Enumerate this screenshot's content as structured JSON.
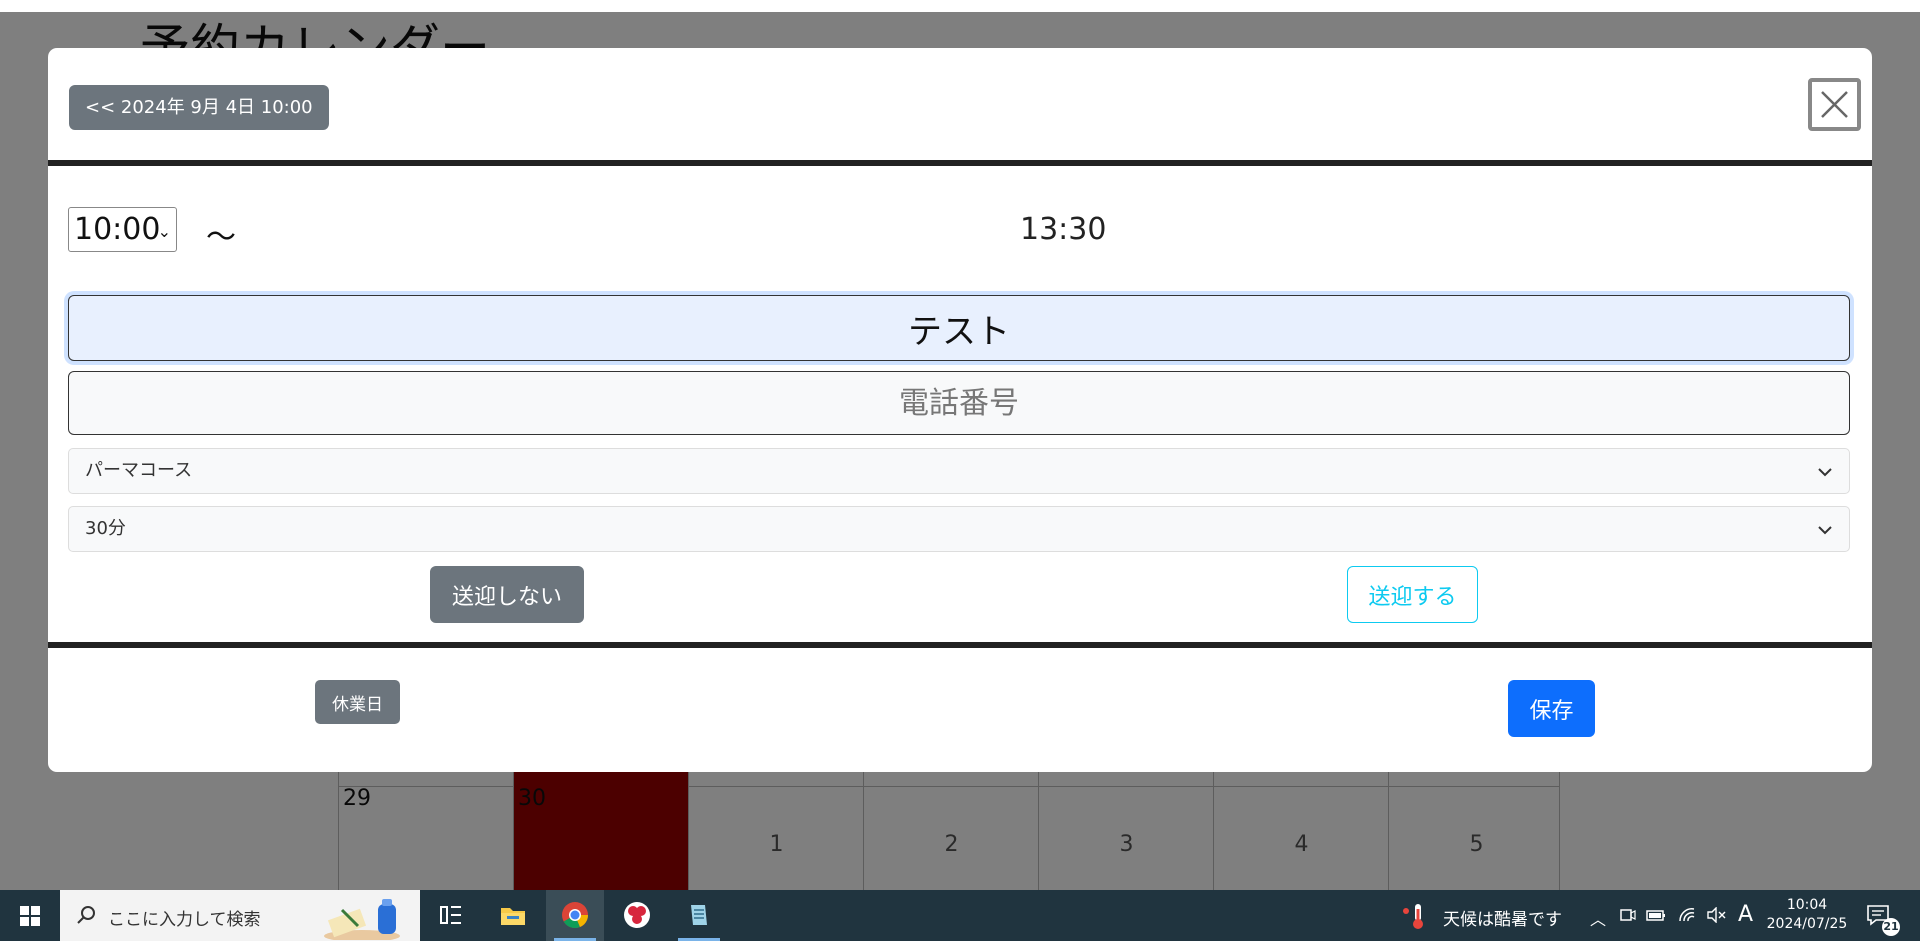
{
  "background": {
    "page_title": "予約カレンダー",
    "calendar_days": [
      {
        "num": "29",
        "today": false,
        "pos": "corner"
      },
      {
        "num": "30",
        "today": true,
        "pos": "corner"
      },
      {
        "num": "1",
        "today": false,
        "pos": "center"
      },
      {
        "num": "2",
        "today": false,
        "pos": "center"
      },
      {
        "num": "3",
        "today": false,
        "pos": "center"
      },
      {
        "num": "4",
        "today": false,
        "pos": "center"
      },
      {
        "num": "5",
        "today": false,
        "pos": "center"
      }
    ]
  },
  "modal": {
    "prev_label": "<< 2024年 9月 4日 10:00",
    "start_time": "10:00",
    "tilde": "〜",
    "end_time": "13:30",
    "name_value": "テスト",
    "phone_placeholder": "電話番号",
    "course_selected": "パーマコース",
    "duration_selected": "30分",
    "pickup_no_label": "送迎しない",
    "pickup_yes_label": "送迎する",
    "holiday_label": "休業日",
    "save_label": "保存"
  },
  "taskbar": {
    "search_placeholder": "ここに入力して検索",
    "weather_text": "天候は酷暑です",
    "ime_indicator": "A",
    "time": "10:04",
    "date": "2024/07/25",
    "notification_count": "21"
  },
  "colors": {
    "today_cell": "#990000",
    "primary": "#0d6efd",
    "secondary": "#6c757d",
    "info": "#0dcaf0"
  }
}
